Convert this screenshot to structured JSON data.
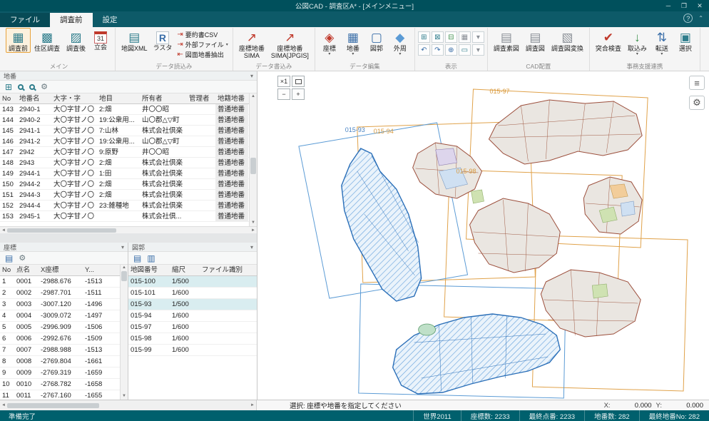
{
  "window": {
    "title": "公図CAD - 調査区A* - [メインメニュー]",
    "min": "─",
    "max": "❐",
    "close": "✕",
    "help": "?",
    "collapse": "⌃"
  },
  "tabs": [
    {
      "label": "ファイル",
      "cls": "tab-file"
    },
    {
      "label": "調査前",
      "cls": "active"
    },
    {
      "label": "設定",
      "cls": ""
    }
  ],
  "ribbon": {
    "group_names": [
      "メイン",
      "データ読込み",
      "データ書込み",
      "データ編集",
      "表示",
      "CAD配置",
      "事務支援連携"
    ],
    "main": [
      {
        "label": "調査前",
        "label2": "",
        "glyph": "▦",
        "cls": "ic-teal",
        "caret": "",
        "state": "active"
      },
      {
        "label": "住区調査",
        "label2": "",
        "glyph": "▩",
        "cls": "ic-teal",
        "caret": "",
        "state": ""
      },
      {
        "label": "調査後",
        "label2": "",
        "glyph": "▨",
        "cls": "ic-teal",
        "caret": "",
        "state": ""
      },
      {
        "label": "立会",
        "label2": "",
        "glyph": "31",
        "cls": "ic-cal",
        "caret": "",
        "state": ""
      }
    ],
    "read_big": [
      {
        "label": "地図XML",
        "label2": "",
        "glyph": "▤",
        "cls": "ic-teal",
        "caret": "",
        "state": ""
      },
      {
        "label": "ラスタ",
        "label2": "",
        "glyph": "R",
        "cls": "ic-r",
        "caret": "",
        "state": ""
      }
    ],
    "read_small": [
      {
        "label": "要約書CSV",
        "glyph": "⇥",
        "caret": ""
      },
      {
        "label": "外部ファイル",
        "glyph": "⇥",
        "caret": "▾"
      },
      {
        "label": "図面地番抽出",
        "glyph": "⇤",
        "caret": ""
      }
    ],
    "write": [
      {
        "label": "座標地番",
        "label2": "SIMA",
        "glyph": "↗",
        "cls": "ic-red",
        "caret": "",
        "state": ""
      },
      {
        "label": "座標地番",
        "label2": "SIMA[JPGIS]",
        "glyph": "↗",
        "cls": "ic-red",
        "caret": "",
        "state": ""
      }
    ],
    "edit": [
      {
        "label": "座標",
        "label2": "",
        "glyph": "◈",
        "cls": "ic-red",
        "caret": "▾",
        "state": ""
      },
      {
        "label": "地番",
        "label2": "",
        "glyph": "▦",
        "cls": "ic-blue",
        "caret": "▾",
        "state": ""
      },
      {
        "label": "図郭",
        "label2": "",
        "glyph": "▢",
        "cls": "ic-blue",
        "caret": "",
        "state": ""
      },
      {
        "label": "外周",
        "label2": "",
        "glyph": "◆",
        "cls": "ic-sky",
        "caret": "▾",
        "state": ""
      }
    ],
    "view_row1": [
      {
        "glyph": "⊞",
        "cls": "ic-teal"
      },
      {
        "glyph": "⊠",
        "cls": "ic-teal"
      },
      {
        "glyph": "⊟",
        "cls": "ic-green"
      },
      {
        "glyph": "▦",
        "cls": "ic-gray"
      },
      {
        "glyph": "▾",
        "cls": "ic-gray"
      }
    ],
    "view_row2": [
      {
        "glyph": "↶",
        "cls": "ic-blue"
      },
      {
        "glyph": "↷",
        "cls": "ic-blue"
      },
      {
        "glyph": "⊕",
        "cls": "ic-blue"
      },
      {
        "glyph": "▭",
        "cls": "ic-teal"
      },
      {
        "glyph": "▾",
        "cls": "ic-gray"
      }
    ],
    "cad": [
      {
        "label": "調査素図",
        "label2": "",
        "glyph": "▤",
        "cls": "ic-gray",
        "caret": "",
        "state": ""
      },
      {
        "label": "調査図",
        "label2": "",
        "glyph": "▤",
        "cls": "ic-gray",
        "caret": "",
        "state": ""
      },
      {
        "label": "調査図変換",
        "label2": "",
        "glyph": "▧",
        "cls": "ic-gray",
        "caret": "",
        "state": ""
      }
    ],
    "office": [
      {
        "label": "突合検査",
        "label2": "",
        "glyph": "✔",
        "cls": "ic-red",
        "caret": "",
        "state": ""
      },
      {
        "label": "取込み",
        "label2": "",
        "glyph": "↓",
        "cls": "ic-green",
        "caret": "▾",
        "state": ""
      },
      {
        "label": "転送",
        "label2": "",
        "glyph": "⇅",
        "cls": "ic-blue",
        "caret": "▾",
        "state": ""
      },
      {
        "label": "選択",
        "label2": "",
        "glyph": "▣",
        "cls": "ic-teal",
        "caret": "",
        "state": ""
      }
    ]
  },
  "parcel_panel": {
    "title": "地番",
    "collapse": "▾",
    "columns": [
      "No",
      "地番名",
      "大字・字",
      "地目",
      "所有者",
      "管理者",
      "地籍地番"
    ],
    "rows": [
      {
        "no": "143",
        "name": "2940-1",
        "oaza": "大〇字甘ノ〇",
        "chimoku": "2:畑",
        "owner": "井〇〇昭",
        "manager": "",
        "type": "普通地番"
      },
      {
        "no": "144",
        "name": "2940-2",
        "oaza": "大〇字甘ノ〇",
        "chimoku": "19:公衆用...",
        "owner": "山〇郡△▽町",
        "manager": "",
        "type": "普通地番"
      },
      {
        "no": "145",
        "name": "2941-1",
        "oaza": "大〇字甘ノ〇",
        "chimoku": "7:山林",
        "owner": "株式会社倶楽",
        "manager": "",
        "type": "普通地番"
      },
      {
        "no": "146",
        "name": "2941-2",
        "oaza": "大〇字甘ノ〇",
        "chimoku": "19:公衆用...",
        "owner": "山〇郡△▽町",
        "manager": "",
        "type": "普通地番"
      },
      {
        "no": "147",
        "name": "2942",
        "oaza": "大〇字甘ノ〇",
        "chimoku": "9:原野",
        "owner": "井〇〇昭",
        "manager": "",
        "type": "普通地番"
      },
      {
        "no": "148",
        "name": "2943",
        "oaza": "大〇字甘ノ〇",
        "chimoku": "2:畑",
        "owner": "株式会社倶楽",
        "manager": "",
        "type": "普通地番"
      },
      {
        "no": "149",
        "name": "2944-1",
        "oaza": "大〇字甘ノ〇",
        "chimoku": "1:田",
        "owner": "株式会社倶楽",
        "manager": "",
        "type": "普通地番"
      },
      {
        "no": "150",
        "name": "2944-2",
        "oaza": "大〇字甘ノ〇",
        "chimoku": "2:畑",
        "owner": "株式会社倶楽",
        "manager": "",
        "type": "普通地番"
      },
      {
        "no": "151",
        "name": "2944-3",
        "oaza": "大〇字甘ノ〇",
        "chimoku": "2:畑",
        "owner": "株式会社倶楽",
        "manager": "",
        "type": "普通地番"
      },
      {
        "no": "152",
        "name": "2944-4",
        "oaza": "大〇字甘ノ〇",
        "chimoku": "23:雑種地",
        "owner": "株式会社倶楽",
        "manager": "",
        "type": "普通地番"
      },
      {
        "no": "153",
        "name": "2945-1",
        "oaza": "大〇字甘ノ〇",
        "chimoku": "",
        "owner": "株式会社倶...",
        "manager": "",
        "type": "普通地番"
      }
    ]
  },
  "coord_panel": {
    "title": "座標",
    "collapse": "▾",
    "columns": [
      "No",
      "点名",
      "X座標",
      "Y..."
    ],
    "rows": [
      {
        "no": "1",
        "name": "0001",
        "x": "-2988.676",
        "y": "-1513"
      },
      {
        "no": "2",
        "name": "0002",
        "x": "-2987.701",
        "y": "-1511"
      },
      {
        "no": "3",
        "name": "0003",
        "x": "-3007.120",
        "y": "-1496"
      },
      {
        "no": "4",
        "name": "0004",
        "x": "-3009.072",
        "y": "-1497"
      },
      {
        "no": "5",
        "name": "0005",
        "x": "-2996.909",
        "y": "-1506"
      },
      {
        "no": "6",
        "name": "0006",
        "x": "-2992.676",
        "y": "-1509"
      },
      {
        "no": "7",
        "name": "0007",
        "x": "-2988.988",
        "y": "-1513"
      },
      {
        "no": "8",
        "name": "0008",
        "x": "-2769.804",
        "y": "-1661"
      },
      {
        "no": "9",
        "name": "0009",
        "x": "-2769.319",
        "y": "-1659"
      },
      {
        "no": "10",
        "name": "0010",
        "x": "-2768.782",
        "y": "-1658"
      },
      {
        "no": "11",
        "name": "0011",
        "x": "-2767.160",
        "y": "-1655"
      }
    ]
  },
  "sheet_panel": {
    "title": "図郭",
    "collapse": "▾",
    "columns": [
      "地図番号",
      "縮尺",
      "ファイル識別"
    ],
    "rows": [
      {
        "num": "015-100",
        "scale": "1/500",
        "file": "",
        "state": "hl"
      },
      {
        "num": "015-101",
        "scale": "1/600",
        "file": "",
        "state": ""
      },
      {
        "num": "015-93",
        "scale": "1/500",
        "file": "",
        "state": "hl"
      },
      {
        "num": "015-94",
        "scale": "1/600",
        "file": "",
        "state": ""
      },
      {
        "num": "015-97",
        "scale": "1/600",
        "file": "",
        "state": ""
      },
      {
        "num": "015-98",
        "scale": "1/600",
        "file": "",
        "state": ""
      },
      {
        "num": "015-99",
        "scale": "1/600",
        "file": "",
        "state": ""
      }
    ]
  },
  "map": {
    "labels": [
      {
        "text": "015-97"
      },
      {
        "text": "015-94"
      },
      {
        "text": "015-93"
      },
      {
        "text": "015-98"
      }
    ],
    "controls": {
      "zoom_1x": "×1",
      "zoom_out": "−",
      "zoom_in": "+"
    },
    "colors": {
      "sheet_frame": "#e0a24a",
      "selected_frame": "#5b9bd5",
      "parcel_stroke": "#9c4f3c",
      "hatch_blue": "#2b6fb8"
    }
  },
  "status_line": {
    "message": "選択: 座標や地番を指定してください",
    "x_label": "X:",
    "x_value": "0.000",
    "y_label": "Y:",
    "y_value": "0.000"
  },
  "statusbar": {
    "ready": "準備完了",
    "items": [
      {
        "text": "世界2011"
      },
      {
        "text": "座標数: 2233"
      },
      {
        "text": "最終点番: 2233"
      },
      {
        "text": "地番数: 282"
      },
      {
        "text": "最終地番No: 282"
      }
    ]
  }
}
